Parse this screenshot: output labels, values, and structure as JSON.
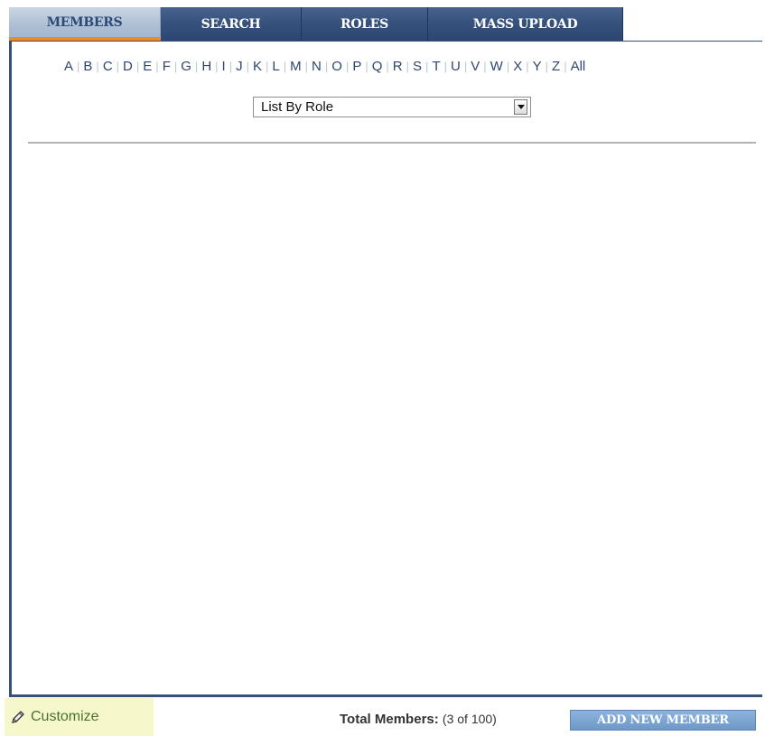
{
  "tabs": [
    {
      "label": "MEMBERS",
      "active": true
    },
    {
      "label": "SEARCH"
    },
    {
      "label": "ROLES"
    },
    {
      "label": "MASS UPLOAD"
    }
  ],
  "alphabet": [
    "A",
    "B",
    "C",
    "D",
    "E",
    "F",
    "G",
    "H",
    "I",
    "J",
    "K",
    "L",
    "M",
    "N",
    "O",
    "P",
    "Q",
    "R",
    "S",
    "T",
    "U",
    "V",
    "W",
    "X",
    "Y",
    "Z",
    "All"
  ],
  "filter": {
    "selected": "List By Role"
  },
  "footer": {
    "customize_label": "Customize",
    "total_label": "Total Members:",
    "total_count": "(3 of 100)",
    "add_button_label": "ADD NEW MEMBER"
  },
  "colors": {
    "tab_bg": "#34507a",
    "active_indicator": "#f08a1c",
    "button_bg": "#7aa4d4",
    "customize_bg": "#f6f8cc"
  },
  "icons": {
    "customize": "pencil-icon",
    "select_arrow": "chevron-down-icon"
  }
}
